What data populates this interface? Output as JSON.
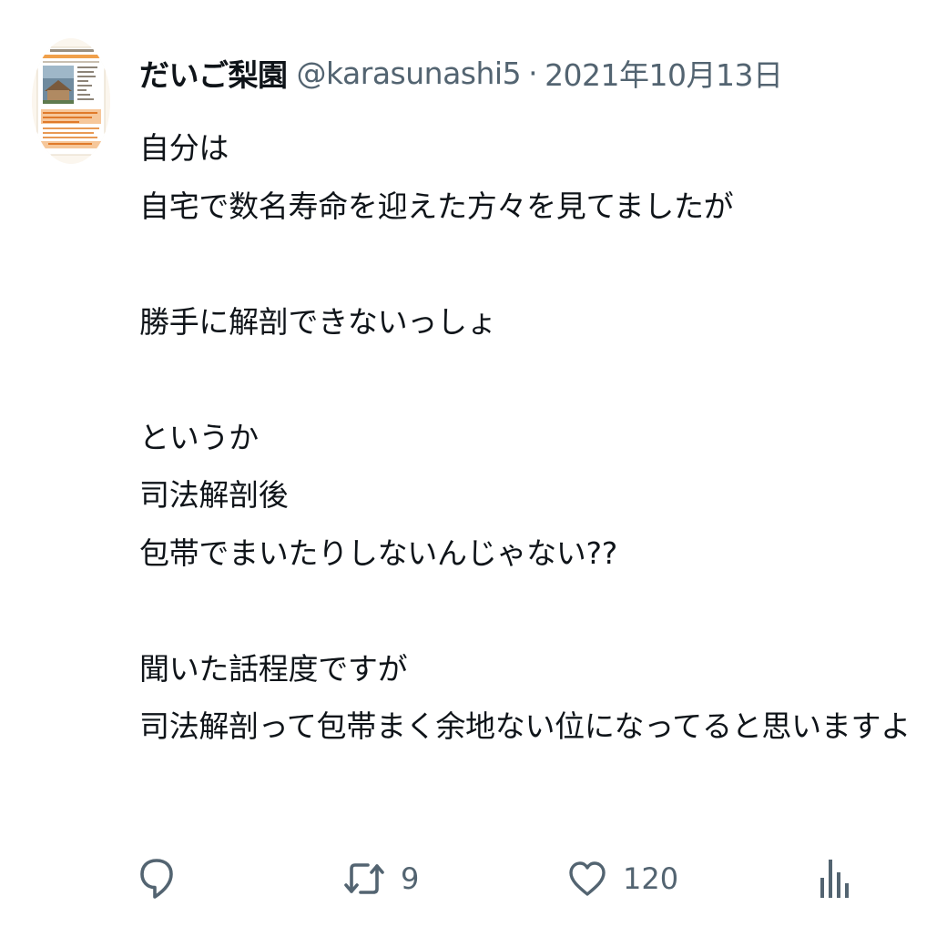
{
  "tweet": {
    "author": {
      "display_name": "だいご梨園",
      "handle": "@karasunashi5"
    },
    "separator": "·",
    "date": "2021年10月13日",
    "text": "自分は\n自宅で数名寿命を迎えた方々を見てましたが\n\n勝手に解剖できないっしょ\n\nというか\n司法解剖後\n包帯でまいたりしないんじゃない??\n\n聞いた話程度ですが\n司法解剖って包帯まく余地ない位になってると思いますよ",
    "actions": {
      "reply": {
        "icon": "reply-icon",
        "count": ""
      },
      "retweet": {
        "icon": "retweet-icon",
        "count": "9"
      },
      "like": {
        "icon": "heart-icon",
        "count": "120"
      },
      "views": {
        "icon": "analytics-icon",
        "count": ""
      }
    }
  },
  "colors": {
    "text_primary": "#0f1419",
    "text_secondary": "#536471",
    "avatar_accent": "#e8862a",
    "background": "#ffffff"
  }
}
